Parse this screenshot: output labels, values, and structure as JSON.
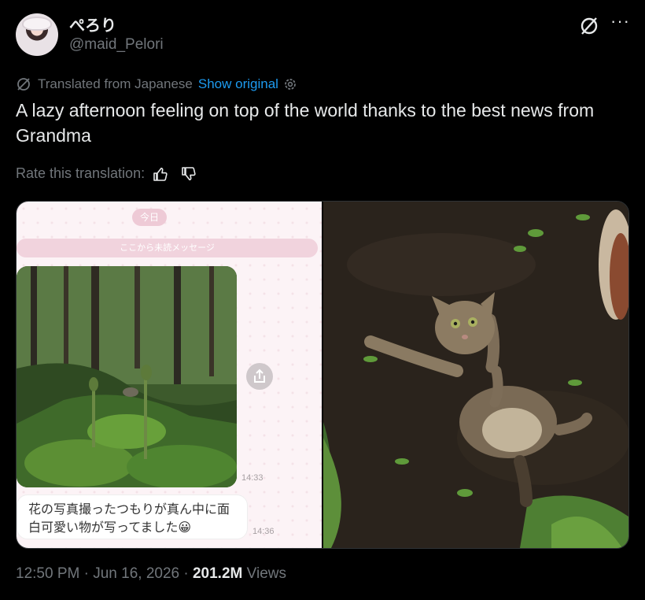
{
  "author": {
    "display_name": "ぺろり",
    "handle": "@maid_Pelori"
  },
  "translation": {
    "notice": "Translated from Japanese",
    "show_original": "Show original"
  },
  "tweet": {
    "text": "A lazy afternoon feeling on top of the world thanks to the best news from Grandma"
  },
  "rate": {
    "label": "Rate this translation:"
  },
  "chat_screenshot": {
    "date_label": "今日",
    "unread_label": "ここから未読メッセージ",
    "photo_time": "14:33",
    "message_text": "花の写真撮ったつもりが真ん中に面白可愛い物が写ってました😀",
    "message_time": "14:36"
  },
  "meta": {
    "time": "12:50 PM",
    "separator": " · ",
    "date": "Jun 16, 2026",
    "views_count": "201.2M",
    "views_label": "Views"
  },
  "colors": {
    "background": "#000000",
    "text": "#e7e9ea",
    "muted": "#71767b",
    "link": "#1d9bf0"
  },
  "icons": [
    "grok-icon",
    "more-icon",
    "translate-icon",
    "settings-icon",
    "thumbs-up-icon",
    "thumbs-down-icon",
    "share-icon"
  ]
}
